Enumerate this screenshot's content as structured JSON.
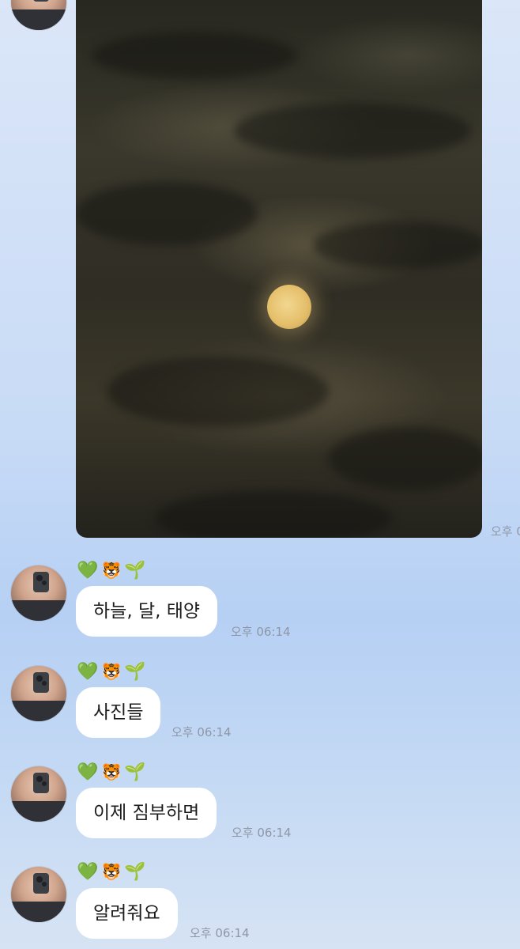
{
  "photo_message": {
    "time": "오후 0"
  },
  "messages": [
    {
      "reactions": [
        "💚",
        "🐯",
        "🌱"
      ],
      "text": "하늘, 달, 태양",
      "time": "오후 06:14"
    },
    {
      "reactions": [
        "💚",
        "🐯",
        "🌱"
      ],
      "text": "사진들",
      "time": "오후 06:14"
    },
    {
      "reactions": [
        "💚",
        "🐯",
        "🌱"
      ],
      "text": "이제 짐부하면",
      "time": "오후 06:14"
    },
    {
      "reactions": [
        "💚",
        "🐯",
        "🌱"
      ],
      "text": "알려줘요",
      "time": "오후 06:14"
    }
  ],
  "icons": {
    "avatar": "profile-photo",
    "photo": "night-sky-moon-photo"
  }
}
